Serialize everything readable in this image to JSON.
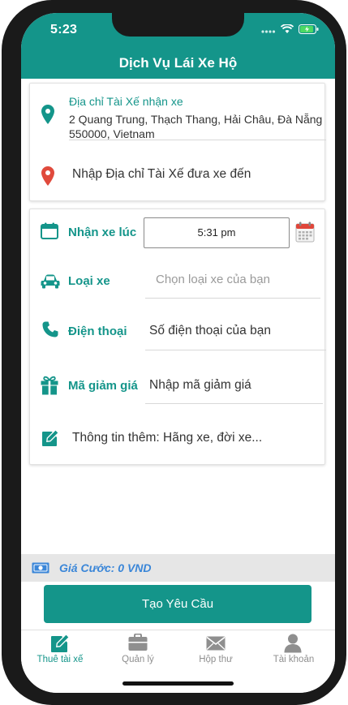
{
  "status": {
    "time": "5:23"
  },
  "header": {
    "title": "Dịch Vụ Lái Xe Hộ"
  },
  "pickup": {
    "label": "Địa chỉ Tài Xế nhận xe",
    "address": "2 Quang Trung, Thạch Thang, Hải Châu, Đà Nẵng 550000, Vietnam"
  },
  "dropoff": {
    "placeholder": "Nhập Địa chỉ Tài Xế đưa xe đến"
  },
  "form": {
    "pickup_time_label": "Nhận xe lúc",
    "pickup_time_value": "5:31 pm",
    "car_type_label": "Loại xe",
    "car_type_placeholder": "Chọn loại xe của bạn",
    "phone_label": "Điện thoại",
    "phone_placeholder": "Số điện thoại của bạn",
    "promo_label": "Mã giảm giá",
    "promo_placeholder": "Nhập mã giảm giá",
    "notes_placeholder": "Thông tin thêm: Hãng xe, đời xe..."
  },
  "price": {
    "text": "Giá Cước: 0 VND"
  },
  "cta": {
    "label": "Tạo Yêu Cầu"
  },
  "tabs": [
    {
      "label": "Thuê tài xế",
      "icon": "edit-icon",
      "active": true
    },
    {
      "label": "Quản lý",
      "icon": "briefcase-icon",
      "active": false
    },
    {
      "label": "Hộp thư",
      "icon": "mail-icon",
      "active": false
    },
    {
      "label": "Tài khoản",
      "icon": "user-icon",
      "active": false
    }
  ],
  "colors": {
    "primary": "#14958a",
    "price": "#3a86d8",
    "pin_red": "#e04a3c"
  }
}
